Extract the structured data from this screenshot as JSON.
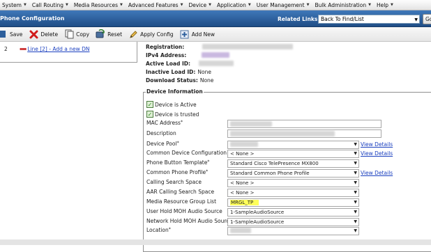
{
  "menu": {
    "items": [
      "System",
      "Call Routing",
      "Media Resources",
      "Advanced Features",
      "Device",
      "Application",
      "User Management",
      "Bulk Administration",
      "Help"
    ]
  },
  "header": {
    "title": "Phone Configuration",
    "related_links_label": "Related Links:",
    "related_links_value": "Back To Find/List",
    "go_label": "Go"
  },
  "toolbar": {
    "save": "Save",
    "delete": "Delete",
    "copy": "Copy",
    "reset": "Reset",
    "apply_config": "Apply Config",
    "add_new": "Add New"
  },
  "lines": {
    "number": "2",
    "link": "Line [2] - Add a new DN"
  },
  "status": {
    "registration_label": "Registration:",
    "ipv4_label": "IPv4 Address:",
    "active_load_label": "Active Load ID:",
    "inactive_load_label": "Inactive Load ID:",
    "inactive_load_value": "None",
    "download_status_label": "Download Status:",
    "download_status_value": "None"
  },
  "device_info": {
    "legend": "Device Information",
    "device_active": "Device is Active",
    "device_trusted": "Device is trusted",
    "mac_address_label": "MAC Address",
    "description_label": "Description",
    "device_pool_label": "Device Pool",
    "common_device_config_label": "Common Device Configuration",
    "common_device_config_value": "< None >",
    "phone_button_template_label": "Phone Button Template",
    "phone_button_template_value": "Standard Cisco TelePresence MX800",
    "common_phone_profile_label": "Common Phone Profile",
    "common_phone_profile_value": "Standard Common Phone Profile",
    "calling_search_space_label": "Calling Search Space",
    "calling_search_space_value": "< None >",
    "aar_css_label": "AAR Calling Search Space",
    "aar_css_value": "< None >",
    "mrgl_label": "Media Resource Group List",
    "mrgl_value": "MRGL_TP",
    "user_hold_label": "User Hold MOH Audio Source",
    "user_hold_value": "1-SampleAudioSource",
    "network_hold_label": "Network Hold MOH Audio Source",
    "network_hold_value": "1-SampleAudioSource",
    "location_label": "Location",
    "view_details": "View Details",
    "required_mark": "*"
  },
  "colors": {
    "header_blue": "#2b5e9e",
    "link_blue": "#1a3fbf",
    "highlight": "#ffff5a"
  }
}
